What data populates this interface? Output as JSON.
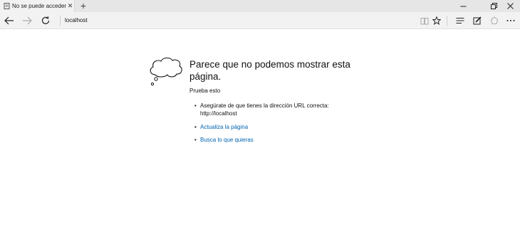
{
  "tab": {
    "title": "No se puede acceder a l",
    "close_glyph": "✕"
  },
  "tabbar": {
    "new_tab_glyph": "+",
    "window_controls": {
      "minimize": "—",
      "restore": "❐",
      "close": "✕"
    }
  },
  "navbar": {
    "address": "localhost",
    "icons": [
      "back-icon",
      "forward-icon",
      "refresh-icon",
      "reading-view-icon",
      "favorite-star-icon",
      "hub-icon",
      "web-note-icon",
      "share-icon",
      "more-icon"
    ]
  },
  "error_page": {
    "title": "Parece que no podemos mostrar esta página.",
    "try_heading": "Prueba esto",
    "suggestion_1_line1": "Asegúrate de que tienes la dirección URL correcta:",
    "suggestion_1_line2": "http://localhost",
    "suggestion_2_link": "Actualiza la página",
    "suggestion_3_link": "Busca lo que quieras",
    "bullet": "•"
  },
  "colors": {
    "tabbar_bg": "#e6e6e6",
    "active_tab_bg": "#f2f2f2",
    "navbar_bg": "#f2f2f2",
    "link": "#0063b1",
    "text": "#111111"
  }
}
